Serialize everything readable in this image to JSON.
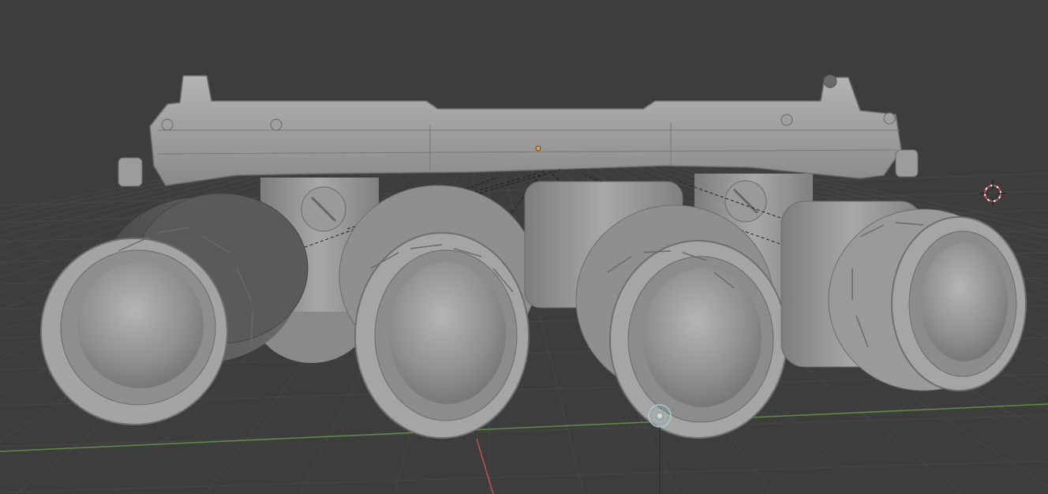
{
  "app": {
    "name": "",
    "view": "3D Viewport"
  },
  "viewport": {
    "background_color": "#3d3d3d",
    "grid_color": "#474747",
    "x_axis_color": "#b5554f",
    "y_axis_color": "#5d8f3f",
    "object_color": "#9a9a9a"
  },
  "scene": {
    "object": "night-vision-goggles-quad-tube",
    "tube_count": 4,
    "overlays": [
      "3d-cursor",
      "object-origin",
      "light-gizmo",
      "relationship-lines"
    ]
  },
  "icons": {
    "cursor": "crosshair-ring-icon",
    "origin": "origin-dot-icon",
    "light": "sun-lamp-icon"
  }
}
